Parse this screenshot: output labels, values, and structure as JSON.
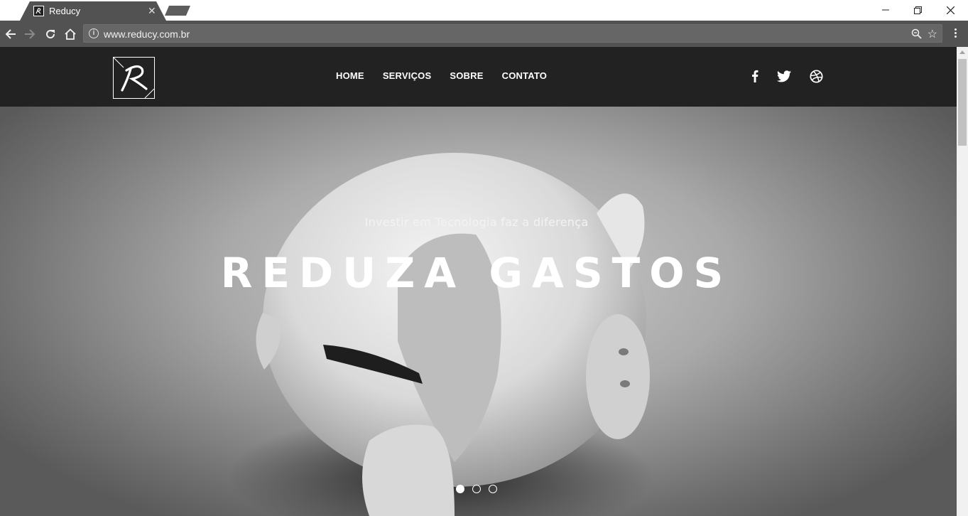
{
  "browser": {
    "tab_title": "Reducy",
    "tab_close": "✕",
    "url": "www.reducy.com.br"
  },
  "site": {
    "nav": [
      "HOME",
      "SERVIÇOS",
      "SOBRE",
      "CONTATO"
    ],
    "social_icons": [
      "facebook-icon",
      "twitter-icon",
      "dribbble-icon"
    ]
  },
  "hero": {
    "subtitle": "Investir em Tecnologia faz a diferença",
    "title": "REDUZA GASTOS",
    "slides": 3,
    "active_slide": 1
  },
  "colors": {
    "header_bg": "#222222",
    "chrome_bg": "#525252"
  }
}
